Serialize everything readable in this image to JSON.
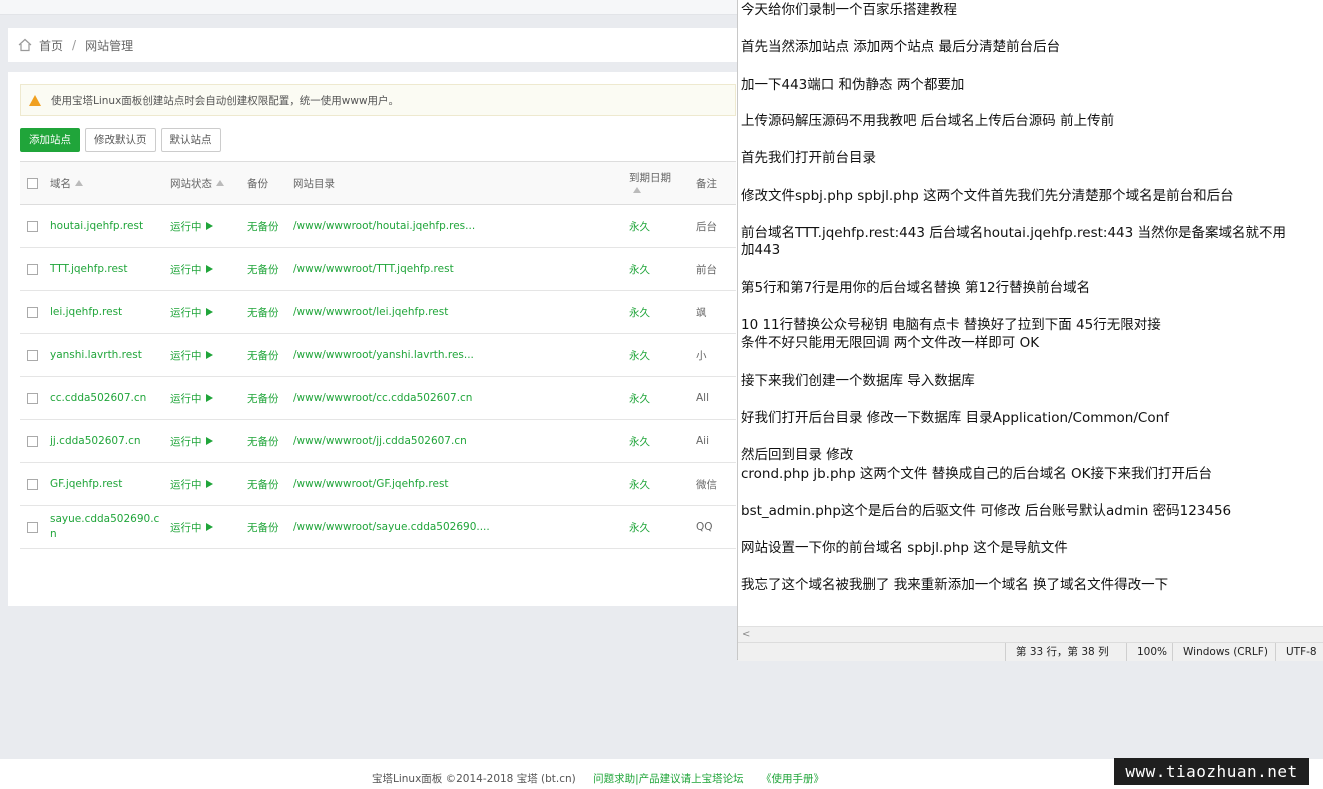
{
  "breadcrumb": {
    "home": "首页",
    "sep": "/",
    "current": "网站管理"
  },
  "alert": {
    "text": "使用宝塔Linux面板创建站点时会自动创建权限配置，统一使用www用户。"
  },
  "buttons": {
    "add": "添加站点",
    "modify_default": "修改默认页",
    "default_site": "默认站点"
  },
  "table": {
    "headers": {
      "domain": "域名",
      "status": "网站状态",
      "backup": "备份",
      "dir": "网站目录",
      "expire": "到期日期",
      "remark": "备注"
    },
    "rows": [
      {
        "domain": "houtai.jqehfp.rest",
        "status": "运行中",
        "backup": "无备份",
        "dir": "/www/wwwroot/houtai.jqehfp.res...",
        "expire": "永久",
        "remark": "后台"
      },
      {
        "domain": "TTT.jqehfp.rest",
        "status": "运行中",
        "backup": "无备份",
        "dir": "/www/wwwroot/TTT.jqehfp.rest",
        "expire": "永久",
        "remark": "前台"
      },
      {
        "domain": "lei.jqehfp.rest",
        "status": "运行中",
        "backup": "无备份",
        "dir": "/www/wwwroot/lei.jqehfp.rest",
        "expire": "永久",
        "remark": "飒"
      },
      {
        "domain": "yanshi.lavrth.rest",
        "status": "运行中",
        "backup": "无备份",
        "dir": "/www/wwwroot/yanshi.lavrth.res...",
        "expire": "永久",
        "remark": "小"
      },
      {
        "domain": "cc.cdda502607.cn",
        "status": "运行中",
        "backup": "无备份",
        "dir": "/www/wwwroot/cc.cdda502607.cn",
        "expire": "永久",
        "remark": "All"
      },
      {
        "domain": "jj.cdda502607.cn",
        "status": "运行中",
        "backup": "无备份",
        "dir": "/www/wwwroot/jj.cdda502607.cn",
        "expire": "永久",
        "remark": "Aii"
      },
      {
        "domain": "GF.jqehfp.rest",
        "status": "运行中",
        "backup": "无备份",
        "dir": "/www/wwwroot/GF.jqehfp.rest",
        "expire": "永久",
        "remark": "微信"
      },
      {
        "domain": "sayue.cdda502690.c\nn",
        "status": "运行中",
        "backup": "无备份",
        "dir": "/www/wwwroot/sayue.cdda502690....",
        "expire": "永久",
        "remark": "QQ"
      }
    ]
  },
  "notepad": {
    "lines": [
      "今天给你们录制一个百家乐搭建教程",
      "",
      "首先当然添加站点  添加两个站点 最后分清楚前台后台",
      "",
      "加一下443端口  和伪静态  两个都要加",
      "",
      "上传源码解压源码不用我教吧  后台域名上传后台源码 前上传前",
      "",
      "首先我们打开前台目录",
      "",
      "修改文件spbj.php    spbjl.php 这两个文件首先我们先分清楚那个域名是前台和后台",
      "",
      "前台域名TTT.jqehfp.rest:443    后台域名houtai.jqehfp.rest:443 当然你是备案域名就不用",
      "加443",
      "",
      "第5行和第7行是用你的后台域名替换 第12行替换前台域名",
      "",
      "10 11行替换公众号秘钥    电脑有点卡 替换好了拉到下面 45行无限对接",
      "条件不好只能用无限回调  两个文件改一样即可 OK",
      "",
      "接下来我们创建一个数据库 导入数据库",
      "",
      "好我们打开后台目录  修改一下数据库 目录Application/Common/Conf",
      "",
      "然后回到目录 修改",
      "crond.php     jb.php  这两个文件   替换成自己的后台域名  OK接下来我们打开后台",
      "",
      "bst_admin.php这个是后台的后驱文件   可修改   后台账号默认admin   密码123456",
      "",
      "网站设置一下你的前台域名       spbjl.php 这个是导航文件",
      "",
      "我忘了这个域名被我删了    我来重新添加一个域名    换了域名文件得改一下"
    ],
    "status": {
      "position": "第 33 行，第 38 列",
      "zoom": "100%",
      "eol": "Windows (CRLF)",
      "encoding": "UTF-8"
    },
    "scroll_arrow": "<"
  },
  "footer": {
    "copyright": "宝塔Linux面板 ©2014-2018 宝塔 (bt.cn)",
    "help": "问题求助|产品建议请上宝塔论坛",
    "manual": "《使用手册》"
  },
  "watermark": "www.tiaozhuan.net",
  "colors": {
    "accent": "#20a53a",
    "warning": "#f0a020"
  },
  "icons": {
    "home": "home-icon",
    "warning": "warning-icon",
    "play": "play-icon",
    "sort": "sort-asc-icon"
  }
}
